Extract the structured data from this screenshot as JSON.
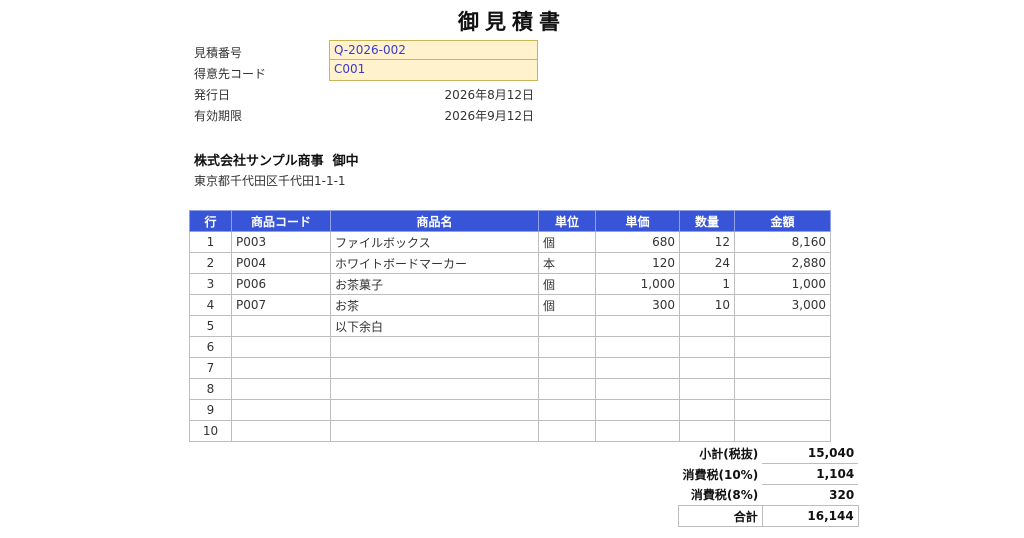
{
  "title": "御見積書",
  "meta": {
    "quote_no_label": "見積番号",
    "quote_no": "Q-2026-002",
    "customer_code_label": "得意先コード",
    "customer_code": "C001",
    "issue_date_label": "発行日",
    "issue_date": "2026年8月12日",
    "valid_until_label": "有効期限",
    "valid_until": "2026年9月12日"
  },
  "customer": {
    "name": "株式会社サンプル商事  御中",
    "address": "東京都千代田区千代田1-1-1"
  },
  "table": {
    "headers": [
      "行",
      "商品コード",
      "商品名",
      "単位",
      "単価",
      "数量",
      "金額"
    ],
    "rows": [
      {
        "row": "1",
        "code": "P003",
        "name": "ファイルボックス",
        "unit": "個",
        "price": "680",
        "qty": "12",
        "amount": "8,160"
      },
      {
        "row": "2",
        "code": "P004",
        "name": "ホワイトボードマーカー",
        "unit": "本",
        "price": "120",
        "qty": "24",
        "amount": "2,880"
      },
      {
        "row": "3",
        "code": "P006",
        "name": "お茶菓子",
        "unit": "個",
        "price": "1,000",
        "qty": "1",
        "amount": "1,000"
      },
      {
        "row": "4",
        "code": "P007",
        "name": "お茶",
        "unit": "個",
        "price": "300",
        "qty": "10",
        "amount": "3,000"
      },
      {
        "row": "5",
        "code": "",
        "name": "以下余白",
        "unit": "",
        "price": "",
        "qty": "",
        "amount": ""
      },
      {
        "row": "6",
        "code": "",
        "name": "",
        "unit": "",
        "price": "",
        "qty": "",
        "amount": ""
      },
      {
        "row": "7",
        "code": "",
        "name": "",
        "unit": "",
        "price": "",
        "qty": "",
        "amount": ""
      },
      {
        "row": "8",
        "code": "",
        "name": "",
        "unit": "",
        "price": "",
        "qty": "",
        "amount": ""
      },
      {
        "row": "9",
        "code": "",
        "name": "",
        "unit": "",
        "price": "",
        "qty": "",
        "amount": ""
      },
      {
        "row": "10",
        "code": "",
        "name": "",
        "unit": "",
        "price": "",
        "qty": "",
        "amount": ""
      }
    ]
  },
  "totals": {
    "subtotal_label": "小計(税抜)",
    "subtotal": "15,040",
    "tax10_label": "消費税(10%)",
    "tax10": "1,104",
    "tax8_label": "消費税(8%)",
    "tax8": "320",
    "total_label": "合計",
    "total": "16,144"
  },
  "colors": {
    "header_bg": "#3755d6",
    "input_bg": "#fff2cc",
    "input_text": "#3a3acb"
  }
}
